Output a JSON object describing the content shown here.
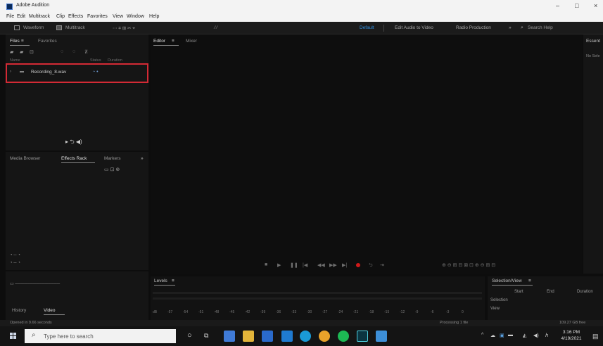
{
  "window": {
    "title": "Adobe Audition",
    "minimize": "–",
    "maximize": "□",
    "close": "×"
  },
  "menu": [
    "File",
    "Edit",
    "Multitrack",
    "Clip",
    "Effects",
    "Favorites",
    "View",
    "Window",
    "Help"
  ],
  "toolbar": {
    "waveform": "Waveform",
    "multitrack": "Multitrack",
    "workspaces": [
      "Default",
      "Edit Audio to Video",
      "Radio Production"
    ],
    "search_placeholder": "Search Help"
  },
  "files_panel": {
    "tabs": [
      "Files",
      "Favorites"
    ],
    "columns": [
      "Name",
      "Status",
      "Duration"
    ],
    "rows": [
      {
        "name": "Recording_8.wav"
      }
    ]
  },
  "effects_panel": {
    "tabs": [
      "Media Browser",
      "Effects Rack",
      "Markers"
    ]
  },
  "editor": {
    "tabs": [
      "Editor",
      "Mixer"
    ]
  },
  "right_panel": {
    "title": "Essent",
    "subtitle": "No Sele"
  },
  "history_panel": {
    "tabs": [
      "History",
      "Video"
    ]
  },
  "levels": {
    "title": "Levels",
    "ticks": [
      "dB",
      "-57",
      "-54",
      "-51",
      "-48",
      "-45",
      "-42",
      "-39",
      "-36",
      "-33",
      "-30",
      "-27",
      "-24",
      "-21",
      "-18",
      "-15",
      "-12",
      "-9",
      "-6",
      "-3",
      "0"
    ]
  },
  "selection_view": {
    "title": "Selection/View",
    "columns": [
      "Start",
      "End",
      "Duration"
    ],
    "rows": [
      "Selection",
      "View"
    ]
  },
  "status": {
    "left": "Opened in 9.66 seconds",
    "center": "Processing 1 file",
    "right": "109.27 GB free"
  },
  "taskbar": {
    "search_placeholder": "Type here to search",
    "time": "3:16 PM",
    "date": "4/19/2021"
  }
}
